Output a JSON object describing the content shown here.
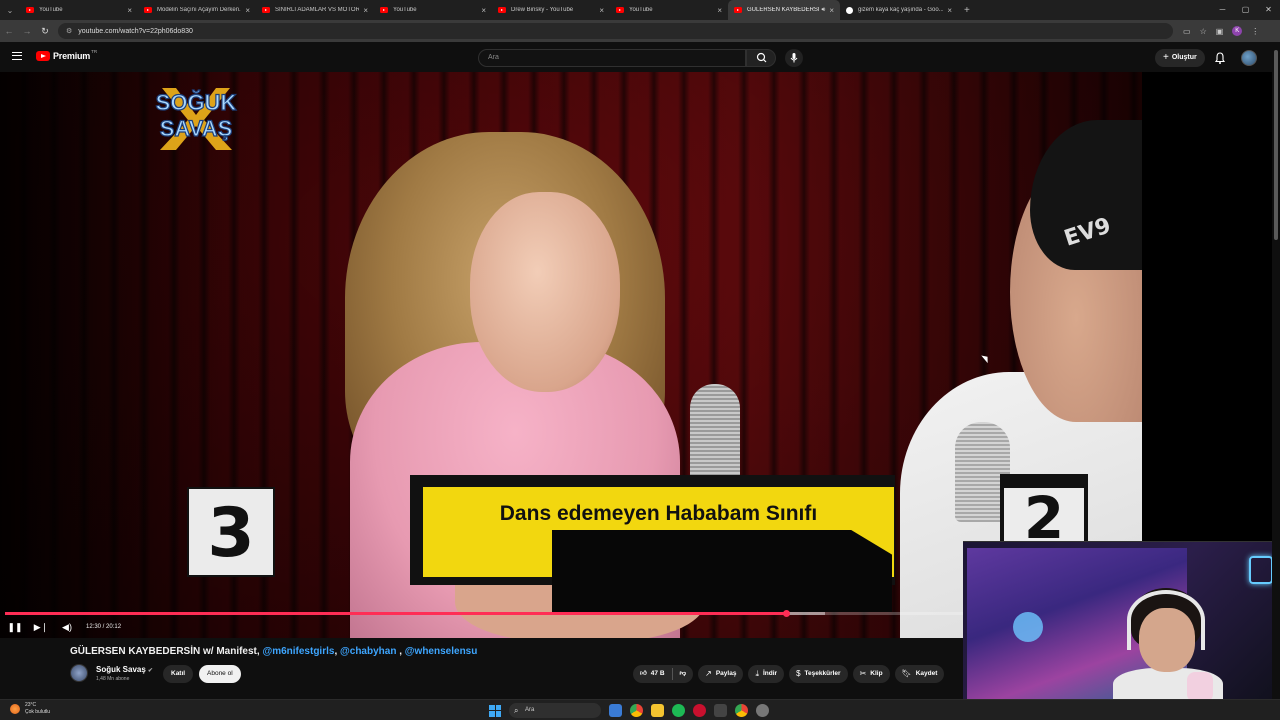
{
  "browser": {
    "tabs": [
      {
        "title": "YouTube",
        "icon": "youtube",
        "active": false
      },
      {
        "title": "Modelin Saçını Açayım Derken...",
        "icon": "youtube",
        "active": false
      },
      {
        "title": "SİNİRLİ ADAMLAR VS MOTORC...",
        "icon": "youtube",
        "active": false
      },
      {
        "title": "YouTube",
        "icon": "youtube",
        "active": false
      },
      {
        "title": "Drew Binsky - YouTube",
        "icon": "youtube",
        "active": false
      },
      {
        "title": "YouTube",
        "icon": "youtube",
        "active": false
      },
      {
        "title": "GÜLERSEN KAYBEDERSİN w",
        "icon": "youtube",
        "active": true
      },
      {
        "title": "gizem kaya kaç yaşında - Goo...",
        "icon": "google",
        "active": false
      }
    ],
    "url": "youtube.com/watch?v=22ph06do830",
    "profile_initial": "K"
  },
  "header": {
    "logo_text": "Premium",
    "logo_region": "TR",
    "search_placeholder": "Ara",
    "create_label": "Oluştur"
  },
  "video": {
    "logo_line1": "SOĞUK",
    "logo_line2": "SAVAŞ",
    "banner_text": "Dans edemeyen Hababam Sınıfı",
    "score_left": "3",
    "score_right": "2",
    "cap_text": "EV9",
    "time_current": "12:30",
    "time_total": "20:12",
    "timecode_display": "12:30 / 20:12",
    "progress_fraction": 0.619,
    "loaded_fraction": 0.65
  },
  "info": {
    "title_main": "GÜLERSEN KAYBEDERSİN w/ Manifest, ",
    "title_tags": [
      "@m6nifestgirls",
      "@chabyhan",
      "@whenselensu"
    ],
    "channel_name": "Soğuk Savaş",
    "subscribers": "1,48 Mn abone",
    "join_label": "Katıl",
    "subscribe_label": "Abone ol",
    "likes": "47 B",
    "share_label": "Paylaş",
    "download_label": "İndir",
    "thanks_label": "Teşekkürler",
    "clip_label": "Klip",
    "save_label": "Kaydet"
  },
  "taskbar": {
    "temperature": "23°C",
    "weather": "Çok bulutlu",
    "search_placeholder": "Ara"
  },
  "colors": {
    "yt_red": "#ff0000",
    "progress_red": "#ff2d55",
    "banner_yellow": "#f2d70f",
    "link_blue": "#3ea6ff"
  }
}
